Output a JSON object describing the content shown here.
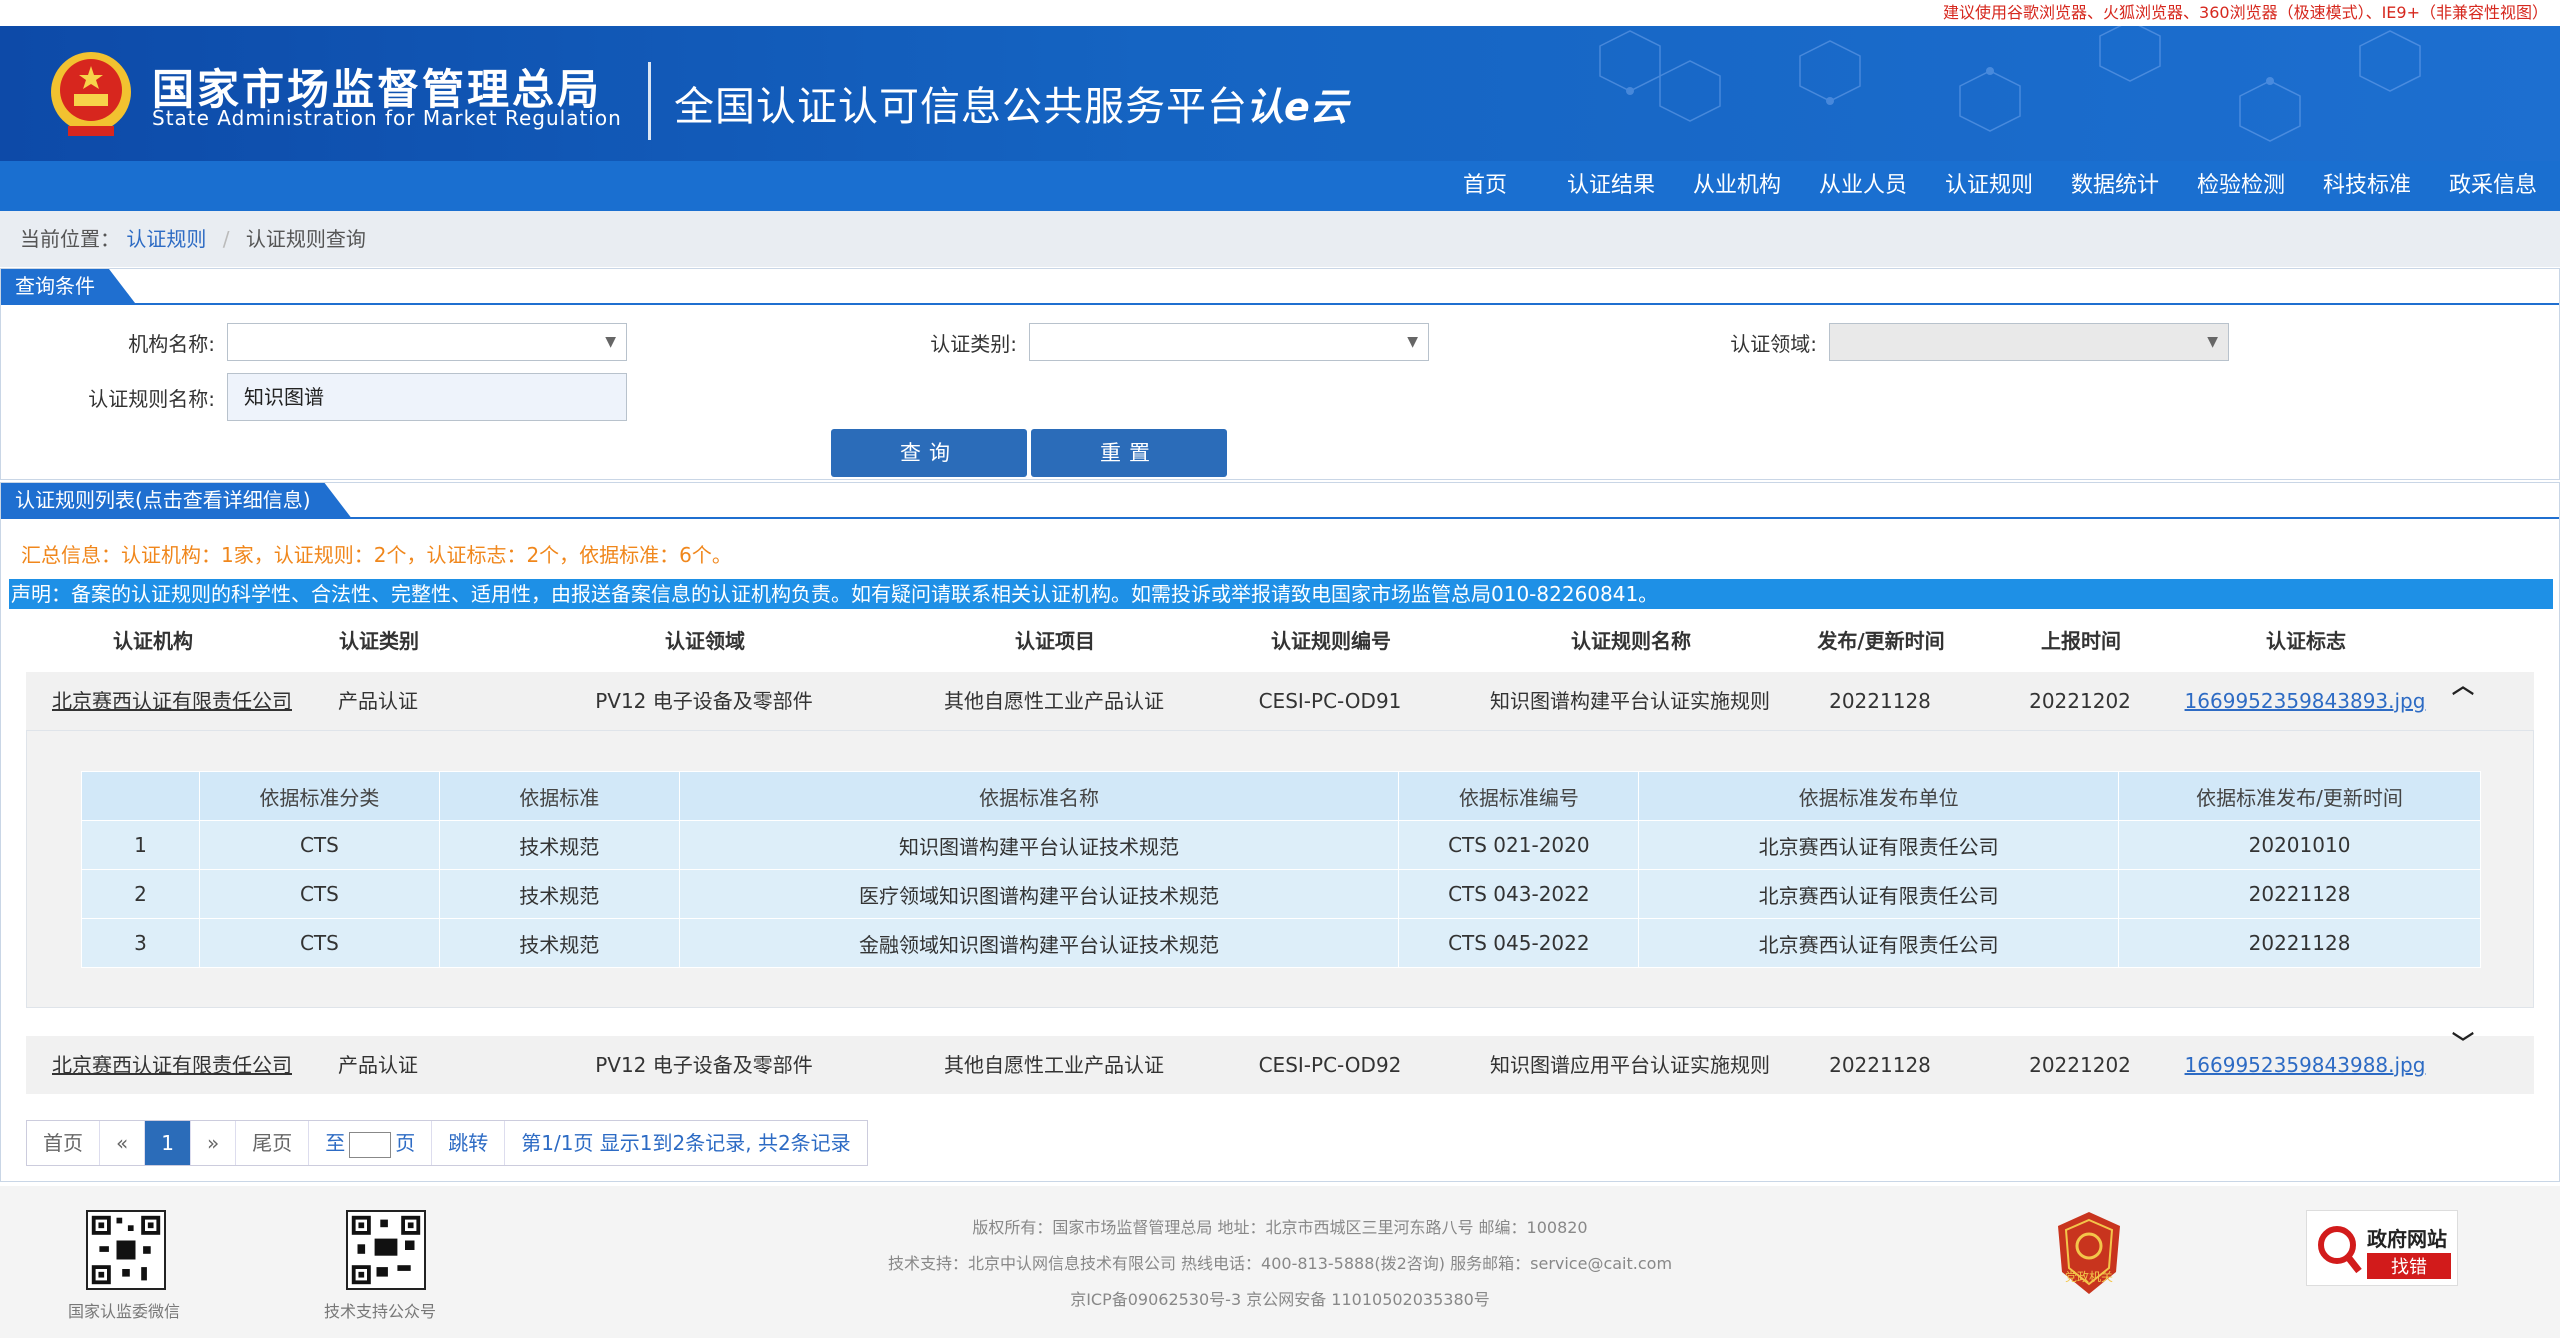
{
  "notice": "建议使用谷歌浏览器、火狐浏览器、360浏览器（极速模式）、IE9+（非兼容性视图）",
  "header": {
    "org_cn": "国家市场监督管理总局",
    "org_en": "State Administration  for  Market Regulation",
    "platform": "全国认证认可信息公共服务平台",
    "platform_logo": "认e云"
  },
  "nav": [
    "首页",
    "认证结果",
    "从业机构",
    "从业人员",
    "认证规则",
    "数据统计",
    "检验检测",
    "科技标准",
    "政采信息"
  ],
  "breadcrumb": {
    "prefix": "当前位置：",
    "level1": "认证规则",
    "level2": "认证规则查询"
  },
  "query": {
    "tab": "查询条件",
    "org_label": "机构名称:",
    "category_label": "认证类别:",
    "field_label": "认证领域:",
    "rule_name_label": "认证规则名称:",
    "rule_name_value": "知识图谱",
    "search_btn": "查询",
    "reset_btn": "重置"
  },
  "list": {
    "tab": "认证规则列表(点击查看详细信息)",
    "summary": "汇总信息：认证机构：1家，认证规则：2个，认证标志：2个，依据标准：6个。",
    "statement": "声明：备案的认证规则的科学性、合法性、完整性、适用性，由报送备案信息的认证机构负责。如有疑问请联系相关认证机构。如需投诉或举报请致电国家市场监管总局010-82260841。",
    "columns": [
      "认证机构",
      "认证类别",
      "认证领域",
      "认证项目",
      "认证规则编号",
      "认证规则名称",
      "发布/更新时间",
      "上报时间",
      "认证标志"
    ],
    "rows": [
      {
        "org": "北京赛西认证有限责任公司",
        "category": "产品认证",
        "field": "PV12 电子设备及零部件",
        "project": "其他自愿性工业产品认证",
        "code": "CESI-PC-OD91",
        "name": "知识图谱构建平台认证实施规则",
        "published": "20221128",
        "reported": "20221202",
        "mark": "1669952359843893.jpg"
      },
      {
        "org": "北京赛西认证有限责任公司",
        "category": "产品认证",
        "field": "PV12 电子设备及零部件",
        "project": "其他自愿性工业产品认证",
        "code": "CESI-PC-OD92",
        "name": "知识图谱应用平台认证实施规则",
        "published": "20221128",
        "reported": "20221202",
        "mark": "1669952359843988.jpg"
      }
    ],
    "detail": {
      "columns": [
        "",
        "依据标准分类",
        "依据标准",
        "依据标准名称",
        "依据标准编号",
        "依据标准发布单位",
        "依据标准发布/更新时间"
      ],
      "rows": [
        [
          "1",
          "CTS",
          "技术规范",
          "知识图谱构建平台认证技术规范",
          "CTS 021-2020",
          "北京赛西认证有限责任公司",
          "20201010"
        ],
        [
          "2",
          "CTS",
          "技术规范",
          "医疗领域知识图谱构建平台认证技术规范",
          "CTS 043-2022",
          "北京赛西认证有限责任公司",
          "20221128"
        ],
        [
          "3",
          "CTS",
          "技术规范",
          "金融领域知识图谱构建平台认证技术规范",
          "CTS 045-2022",
          "北京赛西认证有限责任公司",
          "20221128"
        ]
      ]
    }
  },
  "pager": {
    "first": "首页",
    "prev": "«",
    "current": "1",
    "next": "»",
    "last": "尾页",
    "goto_prefix": "至",
    "goto_suffix": "页",
    "jump": "跳转",
    "info": "第1/1页  显示1到2条记录, 共2条记录"
  },
  "footer": {
    "qr1_label": "国家认监委微信",
    "qr2_label": "技术支持公众号",
    "line1": "版权所有：国家市场监督管理总局    地址：北京市西城区三里河东路八号    邮编：100820",
    "line2": "技术支持：北京中认网信息技术有限公司    热线电话：400-813-5888(拨2咨询)    服务邮箱：service@cait.com",
    "line3": "京ICP备09062530号-3    京公网安备  11010502035380号",
    "badge1": "党政机关",
    "badge2_line1": "政府网站",
    "badge2_line2": "找错"
  },
  "colors": {
    "brand_blue": "#1a6fd0",
    "notice_red": "#d6281e",
    "summary_orange": "#f0871c",
    "statement_blue": "#1e90e6"
  }
}
